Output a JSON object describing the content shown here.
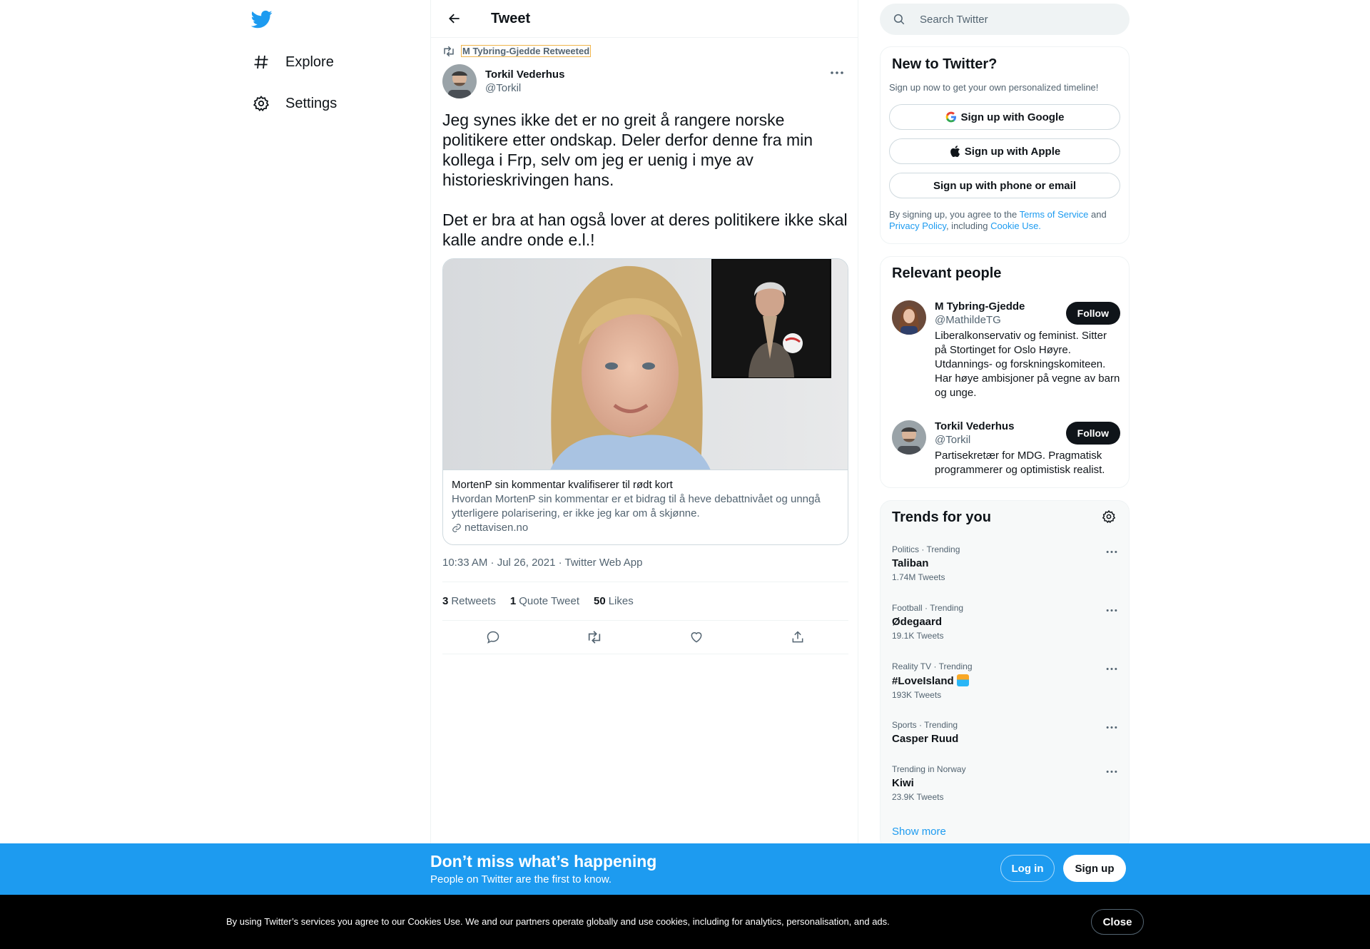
{
  "nav": {
    "explore_label": "Explore",
    "settings_label": "Settings"
  },
  "header": {
    "title": "Tweet"
  },
  "tweet": {
    "retweeted_by": "M Tybring-Gjedde Retweeted",
    "author_name": "Torkil Vederhus",
    "author_handle": "@Torkil",
    "text": "Jeg synes ikke det er no greit å rangere norske politikere etter ondskap. Deler derfor denne fra min kollega i Frp, selv om jeg er uenig i mye av historieskrivingen hans.\n\nDet er bra at han også lover at deres politikere ikke skal kalle andre onde e.l.!",
    "card": {
      "title": "MortenP sin kommentar kvalifiserer til rødt kort",
      "description": "Hvordan MortenP sin kommentar er et bidrag til å heve debattnivået og unngå ytterligere polarisering, er ikke jeg kar om å skjønne.",
      "domain": "nettavisen.no"
    },
    "timestamp": "10:33 AM · Jul 26, 2021 · Twitter Web App",
    "stats": {
      "retweets_count": "3",
      "retweets_label": "Retweets",
      "quotes_count": "1",
      "quotes_label": "Quote Tweet",
      "likes_count": "50",
      "likes_label": "Likes"
    }
  },
  "search": {
    "placeholder": "Search Twitter"
  },
  "signup_panel": {
    "title": "New to Twitter?",
    "subtitle": "Sign up now to get your own personalized timeline!",
    "google_label": "Sign up with Google",
    "apple_label": "Sign up with Apple",
    "phone_label": "Sign up with phone or email",
    "legal_prefix": "By signing up, you agree to the ",
    "terms_link": "Terms of Service",
    "legal_and": " and ",
    "privacy_link": "Privacy Policy",
    "legal_including": ", including ",
    "cookie_link": "Cookie Use."
  },
  "people_panel": {
    "title": "Relevant people",
    "people": [
      {
        "name": "M Tybring-Gjedde",
        "handle": "@MathildeTG",
        "bio": "Liberalkonservativ og feminist. Sitter på Stortinget for Oslo Høyre. Utdannings- og forskningskomiteen. Har høye ambisjoner på vegne av barn og unge.",
        "follow_label": "Follow"
      },
      {
        "name": "Torkil Vederhus",
        "handle": "@Torkil",
        "bio": "Partisekretær for MDG. Pragmatisk programmerer og optimistisk realist.",
        "follow_label": "Follow"
      }
    ]
  },
  "trends_panel": {
    "title": "Trends for you",
    "trends": [
      {
        "category": "Politics · Trending",
        "name": "Taliban",
        "count": "1.74M Tweets"
      },
      {
        "category": "Football · Trending",
        "name": "Ødegaard",
        "count": "19.1K Tweets"
      },
      {
        "category": "Reality TV · Trending",
        "name": "#LoveIsland",
        "count": "193K Tweets"
      },
      {
        "category": "Sports · Trending",
        "name": "Casper Ruud",
        "count": ""
      },
      {
        "category": "Trending in Norway",
        "name": "Kiwi",
        "count": "23.9K Tweets"
      }
    ],
    "show_more": "Show more"
  },
  "banner": {
    "title": "Don’t miss what’s happening",
    "subtitle": "People on Twitter are the first to know.",
    "login_label": "Log in",
    "signup_label": "Sign up"
  },
  "cookie": {
    "text": "By using Twitter’s services you agree to our Cookies Use. We and our partners operate globally and use cookies, including for analytics, personalisation, and ads.",
    "close_label": "Close"
  },
  "colors": {
    "accent": "#1d9bf0",
    "text_primary": "#0f1419",
    "text_secondary": "#536471",
    "border": "#eff3f4"
  },
  "icons": {
    "logo": "twitter-bird-icon",
    "explore": "hashtag-icon",
    "settings": "gear-icon",
    "back": "arrow-left-icon",
    "retweet": "retweet-icon",
    "more": "more-dots-icon",
    "link": "link-icon",
    "reply": "reply-icon",
    "like": "heart-icon",
    "share": "share-icon",
    "search": "search-icon",
    "google": "google-icon",
    "apple": "apple-icon"
  }
}
